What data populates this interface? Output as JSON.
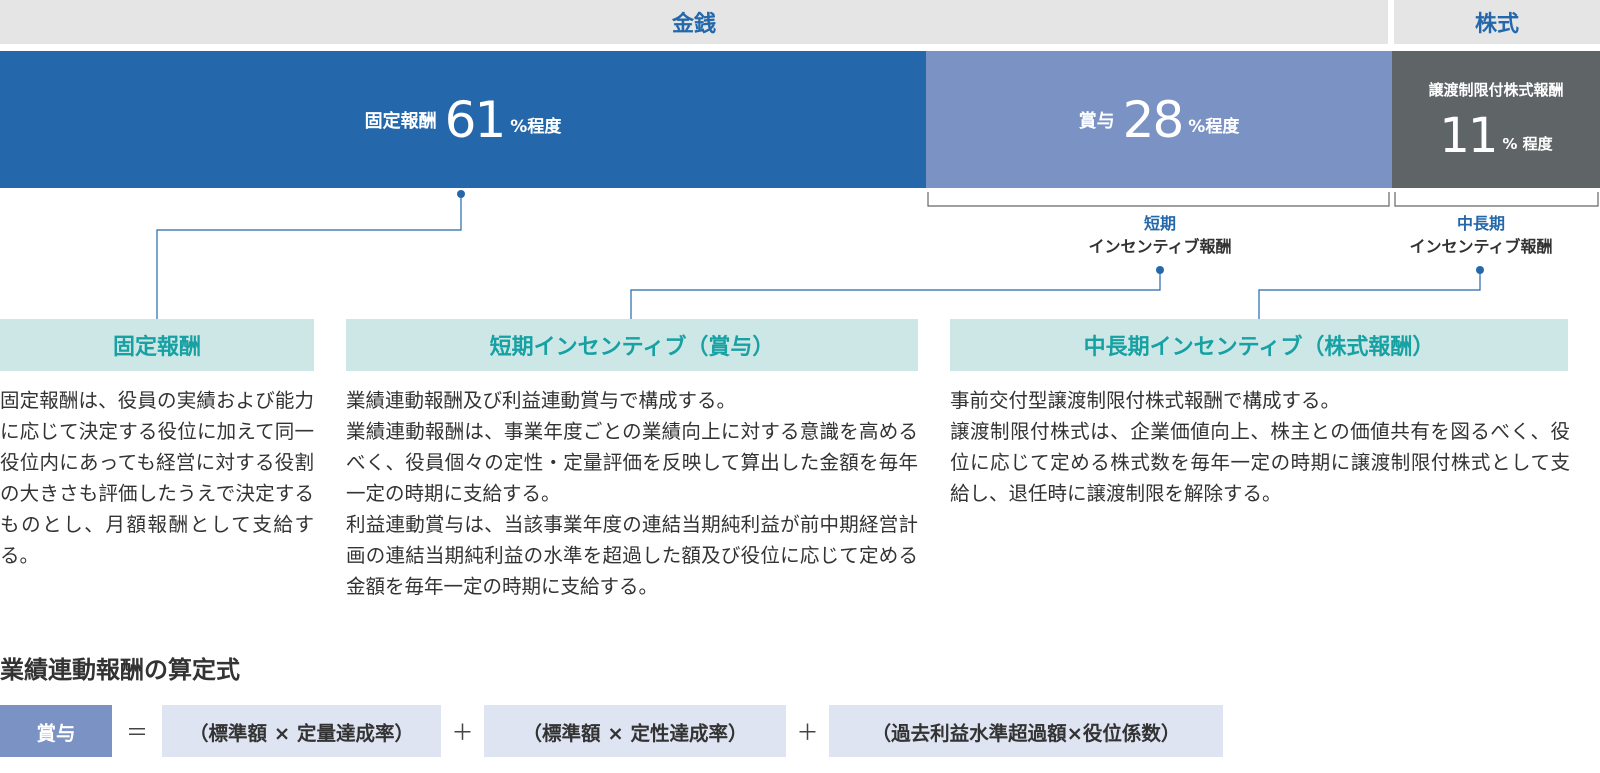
{
  "header": {
    "money": "金銭",
    "stock": "株式"
  },
  "bars": [
    {
      "label": "固定報酬",
      "value": "61",
      "suffix": "%程度",
      "color": "#2468ab"
    },
    {
      "label": "賞与",
      "value": "28",
      "suffix": "%程度",
      "color": "#7a93c4"
    },
    {
      "label": "譲渡制限付株式報酬",
      "value": "11",
      "suffix": "% 程度",
      "color": "#5f6467"
    }
  ],
  "captions": {
    "short": {
      "line1": "短期",
      "line2": "インセンティブ報酬"
    },
    "mid": {
      "line1": "中長期",
      "line2": "インセンティブ報酬"
    }
  },
  "sections": {
    "fixed": {
      "title": "固定報酬",
      "paragraphs": [
        "固定報酬は、役員の実績および能力に応じて決定する役位に加えて同一役位内にあっても経営に対する役割の大きさも評価したうえで決定するものとし、月額報酬として支給する。"
      ]
    },
    "short": {
      "title": "短期インセンティブ（賞与）",
      "paragraphs": [
        "業績連動報酬及び利益連動賞与で構成する。",
        "業績連動報酬は、事業年度ごとの業績向上に対する意識を高めるべく、役員個々の定性・定量評価を反映して算出した金額を毎年一定の時期に支給する。",
        "利益連動賞与は、当該事業年度の連結当期純利益が前中期経営計画の連結当期純利益の水準を超過した額及び役位に応じて定める金額を毎年一定の時期に支給する。"
      ]
    },
    "mid": {
      "title": "中長期インセンティブ（株式報酬）",
      "paragraphs": [
        "事前交付型譲渡制限付株式報酬で構成する。",
        "譲渡制限付株式は、企業価値向上、株主との価値共有を図るべく、役位に応じて定める株式数を毎年一定の時期に譲渡制限付株式として支給し、退任時に譲渡制限を解除する。"
      ]
    }
  },
  "formula": {
    "title": "業績連動報酬の算定式",
    "result": "賞与",
    "equals": "＝",
    "plus": "＋",
    "term1": "（標準額 × 定量達成率）",
    "term2": "（標準額 × 定性達成率）",
    "term3": "（過去利益水準超過額×役位係数）"
  }
}
